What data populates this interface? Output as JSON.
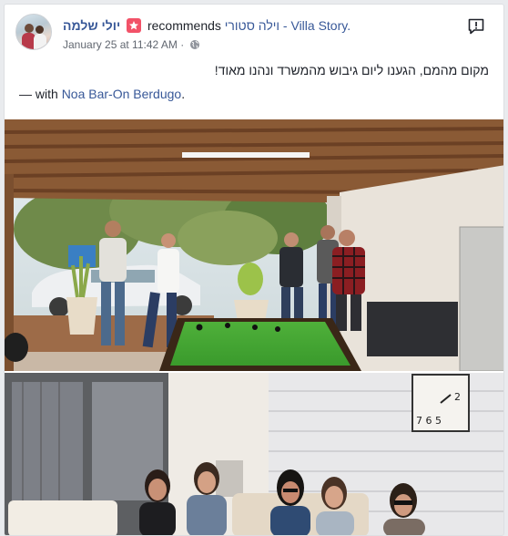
{
  "post": {
    "author": "יולי שלמה",
    "action": "recommends",
    "page_name": "וילה סטורי - Villa Story.",
    "timestamp": "January 25 at 11:42 AM",
    "separator": "·",
    "body": "מקום מהמם, הגענו ליום גיבוש מהמשרד ונהנו מאוד!",
    "with_prefix": "— with",
    "tagged_friend": "Noa Bar-On Berdugo",
    "tagged_suffix": ".",
    "photos": [
      {
        "semantic": "patio-pool-table-photo"
      },
      {
        "semantic": "women-on-sofa-photo"
      }
    ]
  },
  "colors": {
    "link": "#385898",
    "recommend_badge": "#f25268",
    "meta": "#616770",
    "text": "#1d2129"
  },
  "icons": {
    "recommend": "star-badge-icon",
    "privacy": "globe-icon",
    "report": "exclamation-bubble-icon"
  }
}
